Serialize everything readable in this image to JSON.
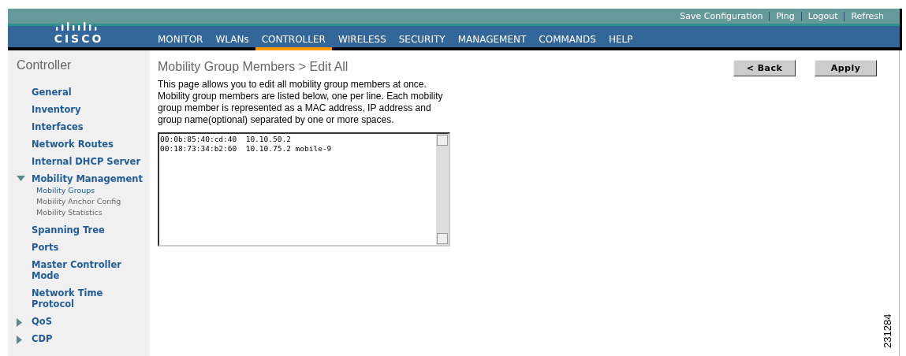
{
  "header": {
    "logo_text": "CISCO",
    "top_links": [
      {
        "label": "Save Configuration"
      },
      {
        "label": "Ping"
      },
      {
        "label": "Logout"
      },
      {
        "label": "Refresh"
      }
    ],
    "tabs": [
      {
        "label": "MONITOR",
        "selected": false
      },
      {
        "label": "WLANs",
        "selected": false
      },
      {
        "label": "CONTROLLER",
        "selected": true
      },
      {
        "label": "WIRELESS",
        "selected": false
      },
      {
        "label": "SECURITY",
        "selected": false
      },
      {
        "label": "MANAGEMENT",
        "selected": false
      },
      {
        "label": "COMMANDS",
        "selected": false
      },
      {
        "label": "HELP",
        "selected": false
      }
    ]
  },
  "sidebar": {
    "title": "Controller",
    "items": [
      {
        "label": "General"
      },
      {
        "label": "Inventory"
      },
      {
        "label": "Interfaces"
      },
      {
        "label": "Network Routes"
      },
      {
        "label": "Internal DHCP Server"
      },
      {
        "label": "Mobility Management",
        "expanded": true,
        "children": [
          {
            "label": "Mobility Groups",
            "selected": true
          },
          {
            "label": "Mobility Anchor Config",
            "selected": false
          },
          {
            "label": "Mobility Statistics",
            "selected": false
          }
        ]
      },
      {
        "label": "Spanning Tree"
      },
      {
        "label": "Ports"
      },
      {
        "label": "Master Controller Mode"
      },
      {
        "label": "Network Time Protocol"
      },
      {
        "label": "QoS",
        "expanded": false
      },
      {
        "label": "CDP",
        "expanded": false
      }
    ]
  },
  "page": {
    "title": "Mobility Group Members > Edit All",
    "buttons": [
      {
        "label": "< Back"
      },
      {
        "label": "Apply"
      }
    ],
    "description": "This page allows you to edit all mobility group members at once. Mobility group members are listed below, one per line. Each mobility group member is represented as a MAC address, IP address and group name(optional) separated by one or more spaces.",
    "members_field": {
      "lines": [
        "00:0b:85:40:cd:40  10.10.50.2",
        "00:18:73:34:b2:60  10.10.75.2 mobile-9"
      ]
    }
  },
  "figure_id": "231284"
}
